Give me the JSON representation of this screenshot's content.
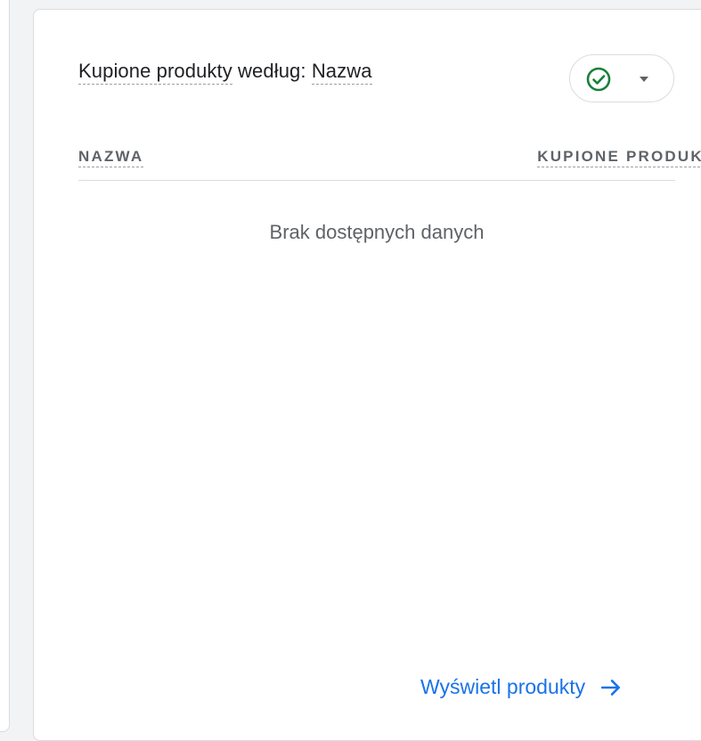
{
  "card": {
    "title_prefix": "Kupione produkty",
    "title_middle": " według: ",
    "title_dimension": "Nazwa",
    "status_icon": "check-circle-icon",
    "status_color": "#188038",
    "dropdown_icon": "caret-down-icon"
  },
  "table": {
    "headers": [
      "NAZWA",
      "KUPIONE PRODUKTY"
    ],
    "rows": [],
    "empty_message": "Brak dostępnych danych"
  },
  "footer": {
    "link_label": "Wyświetl produkty",
    "link_icon": "arrow-right-icon",
    "link_color": "#1a73e8"
  }
}
